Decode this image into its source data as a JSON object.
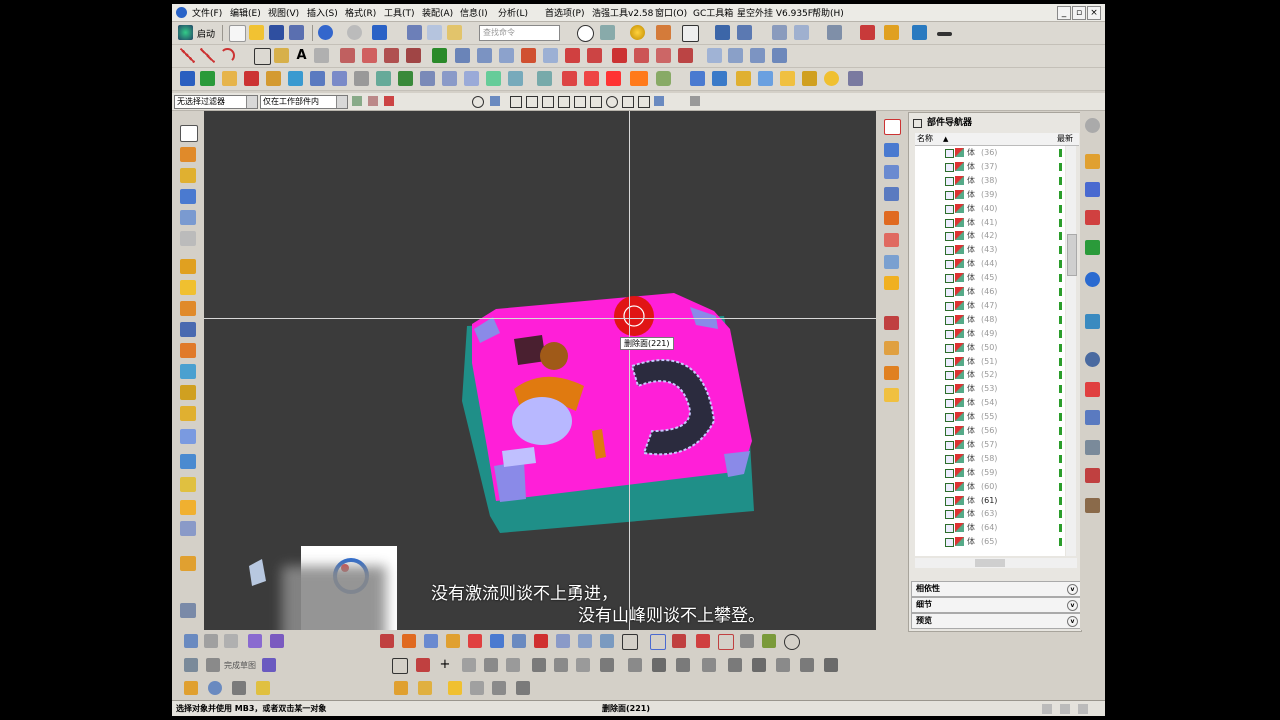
{
  "menu": [
    "文件(F)",
    "编辑(E)",
    "视图(V)",
    "插入(S)",
    "格式(R)",
    "工具(T)",
    "装配(A)",
    "信息(I)",
    "分析(L)",
    "首选项(P)",
    "浩强工具v2.58",
    "窗口(O)",
    "GC工具箱",
    "星空外挂 V6.935F",
    "帮助(H)"
  ],
  "toolbar": {
    "start_label": "启动",
    "search_placeholder": "查找命令",
    "filter_select": "无选择过滤器",
    "scope_select": "仅在工作部件内"
  },
  "viewport": {
    "tooltip": "删除面(221)",
    "subtitle_line1": "没有激流则谈不上勇进，",
    "subtitle_line2": "没有山峰则谈不上攀登。"
  },
  "navigator": {
    "title": "部件导航器",
    "col_name": "名称",
    "col_latest": "最新",
    "body_label": "体",
    "rows": [
      "(36)",
      "(37)",
      "(38)",
      "(39)",
      "(40)",
      "(41)",
      "(42)",
      "(43)",
      "(44)",
      "(45)",
      "(46)",
      "(47)",
      "(48)",
      "(49)",
      "(50)",
      "(51)",
      "(52)",
      "(53)",
      "(54)",
      "(55)",
      "(56)",
      "(57)",
      "(58)",
      "(59)",
      "(60)",
      "(61)",
      "(63)",
      "(64)",
      "(65)"
    ],
    "highlight_row": "(61)",
    "panels": [
      "相依性",
      "细节",
      "预览"
    ]
  },
  "bottom_toolbar": {
    "sketch_label": "完成草图"
  },
  "status": {
    "left": "选择对象并使用 MB3，或者双击某一对象",
    "center": "删除面(221)"
  },
  "colors": {
    "part_face": "#ff1fd8",
    "part_side": "#1f8f88",
    "viewport_bg": "#3b3b3b",
    "cursor": "#e01515"
  }
}
